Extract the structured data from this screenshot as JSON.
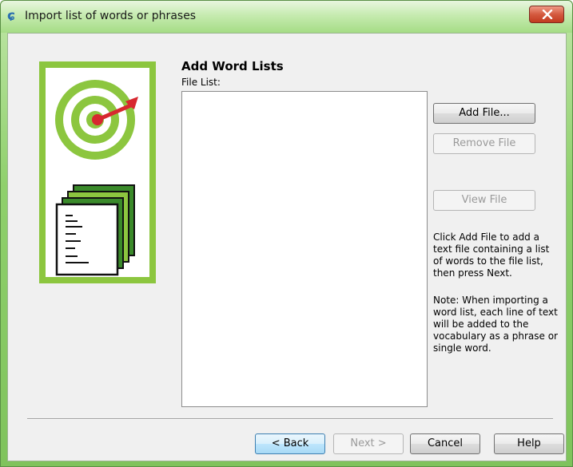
{
  "window": {
    "title": "Import list of words or phrases",
    "app_icon_glyph": "ɕ"
  },
  "main": {
    "heading": "Add Word Lists",
    "file_list_label": "File List:",
    "file_list_items": []
  },
  "side_buttons": {
    "add_file": "Add File...",
    "remove_file": "Remove File",
    "view_file": "View File"
  },
  "help": {
    "instructions": "Click Add File to add a text file containing a list of words to the file list, then press Next.",
    "note": "Note: When importing a word list, each line of text will be added to the vocabulary as a phrase or single word."
  },
  "footer_buttons": {
    "back": "< Back",
    "next": "Next >",
    "cancel": "Cancel",
    "help": "Help"
  },
  "colors": {
    "illustration_green": "#8cc63f",
    "target_dark_green": "#3a8a2a",
    "dart_red": "#d7282f",
    "titlebar_green": "#a5dc85"
  },
  "icons": [
    "app-icon",
    "close-icon",
    "target-icon",
    "documents-icon"
  ]
}
